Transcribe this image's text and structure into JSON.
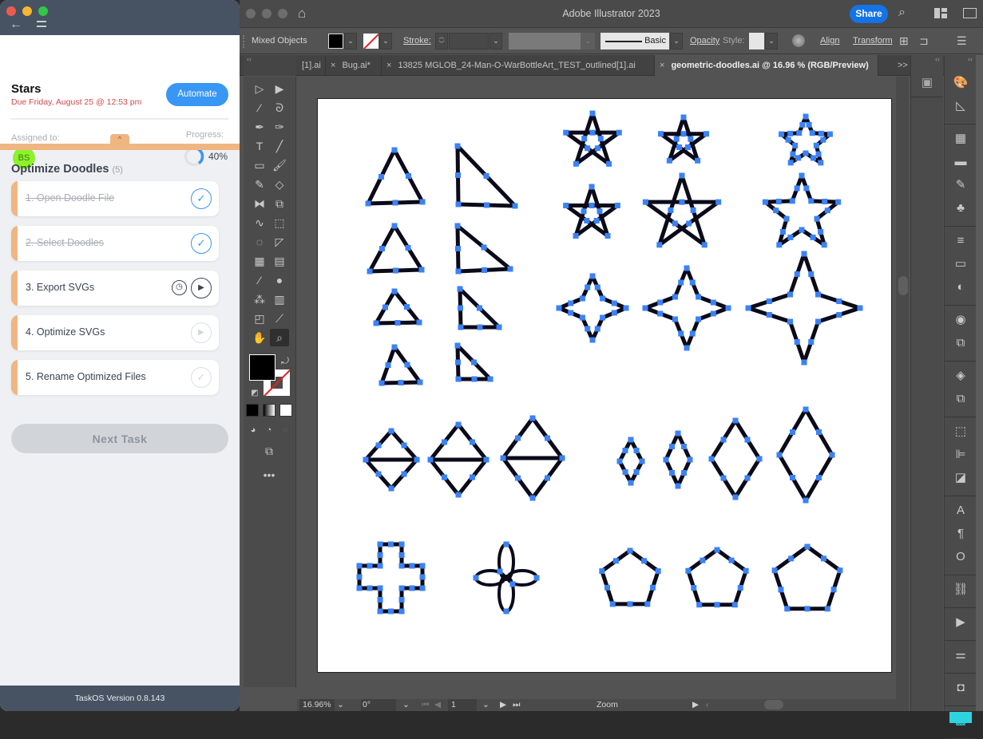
{
  "taskos": {
    "window_controls": [
      "close",
      "minimize",
      "maximize"
    ],
    "nav": {
      "back_icon": "←",
      "menu_icon": "menu-icon"
    },
    "task": {
      "title": "Stars",
      "due": "Due Friday, August 25 @ 12:53 pm",
      "automate_label": "Automate",
      "assigned_label": "Assigned to:",
      "assignee_initials": "BS",
      "progress_label": "Progress:",
      "progress_value": 40,
      "progress_text": "40%",
      "collapse_icon": "^"
    },
    "section": {
      "title": "Optimize Doodles",
      "count": "(5)"
    },
    "steps": [
      {
        "label": "1. Open Doodle File",
        "status": "done",
        "icon": "✓"
      },
      {
        "label": "2. Select Doodles",
        "status": "done",
        "icon": "✓"
      },
      {
        "label": "3. Export SVGs",
        "status": "active",
        "icon": "▶",
        "clock_icon": "◷"
      },
      {
        "label": "4. Optimize SVGs",
        "status": "pending",
        "icon": "▶"
      },
      {
        "label": "5. Rename Optimized Files",
        "status": "pending",
        "icon": "✓"
      }
    ],
    "next_task_label": "Next Task",
    "footer": "TaskOS Version 0.8.143",
    "colors": {
      "accent": "#3896f5",
      "stripe": "#f0b681",
      "due": "#d24b4b",
      "avatar": "#8ef22b",
      "header": "#475362"
    }
  },
  "illustrator": {
    "title": "Adobe Illustrator 2023",
    "share_label": "Share",
    "control_bar": {
      "selection": "Mixed Objects",
      "stroke_label": "Stroke:",
      "brush_label": "Basic",
      "opacity_label": "Opacity",
      "style_label": "Style:",
      "align_label": "Align",
      "transform_label": "Transform"
    },
    "tabs": [
      {
        "label": "[1].ai",
        "active": false
      },
      {
        "label": "Bug.ai*",
        "active": false
      },
      {
        "label": "13825 MGLOB_24-Man-O-WarBottleArt_TEST_outlined[1].ai",
        "active": false
      },
      {
        "label": "geometric-doodles.ai @ 16.96 % (RGB/Preview)",
        "active": true
      }
    ],
    "tabs_overflow": ">>",
    "status_bar": {
      "zoom": "16.96%",
      "rotation": "0°",
      "artboard": "1",
      "tool": "Zoom"
    },
    "tools": [
      "selection-tool",
      "direct-selection-tool",
      "magic-wand-tool",
      "lasso-tool",
      "pen-tool",
      "curvature-tool",
      "type-tool",
      "line-segment-tool",
      "rectangle-tool",
      "paintbrush-tool",
      "pencil-tool",
      "eraser-tool",
      "reflect-tool",
      "scale-tool",
      "warp-tool",
      "free-transform-tool",
      "shape-builder-tool",
      "perspective-grid-tool",
      "mesh-tool",
      "gradient-tool",
      "eyedropper-tool",
      "blend-tool",
      "symbol-sprayer-tool",
      "column-graph-tool",
      "artboard-tool",
      "slice-tool",
      "hand-tool",
      "zoom-tool"
    ],
    "active_tool": "zoom-tool",
    "panels": [
      "color-panel",
      "color-guide-panel",
      "swatches-panel",
      "libraries-panel",
      "brushes-panel",
      "symbols-panel",
      "stroke-panel",
      "gradient-panel",
      "transparency-panel",
      "appearance-panel",
      "graphic-styles-panel",
      "layers-panel",
      "artboards-panel",
      "transform-panel",
      "align-panel",
      "pathfinder-panel",
      "character-panel",
      "paragraph-panel",
      "opentype-panel",
      "links-panel",
      "actions-panel",
      "properties-panel",
      "asset-export-panel",
      "color-themes-panel"
    ],
    "artwork": {
      "stroke_color": "#0a0a1a",
      "anchor_color": "#3b82f6",
      "shapes": [
        {
          "type": "triangle",
          "row": 1,
          "col": 1
        },
        {
          "type": "right-triangle",
          "row": 1,
          "col": 2
        },
        {
          "type": "triangle",
          "row": 2,
          "col": 1
        },
        {
          "type": "right-triangle",
          "row": 2,
          "col": 2
        },
        {
          "type": "triangle",
          "row": 3,
          "col": 1
        },
        {
          "type": "right-triangle",
          "row": 3,
          "col": 2
        },
        {
          "type": "triangle",
          "row": 4,
          "col": 1
        },
        {
          "type": "right-triangle",
          "row": 4,
          "col": 2
        },
        {
          "type": "pentagram",
          "row": 1,
          "col": 3
        },
        {
          "type": "pentagram",
          "row": 1,
          "col": 4
        },
        {
          "type": "star-outline",
          "row": 1,
          "col": 5
        },
        {
          "type": "pentagram",
          "row": 2,
          "col": 3
        },
        {
          "type": "pentagram",
          "row": 2,
          "col": 4
        },
        {
          "type": "star-outline",
          "row": 2,
          "col": 5
        },
        {
          "type": "four-point-star",
          "row": 3,
          "col": 3
        },
        {
          "type": "four-point-star",
          "row": 3,
          "col": 4
        },
        {
          "type": "four-point-star",
          "row": 3,
          "col": 5
        },
        {
          "type": "divided-diamond",
          "count": 3
        },
        {
          "type": "diamond",
          "count": 4
        },
        {
          "type": "cross",
          "count": 1
        },
        {
          "type": "quatrefoil",
          "count": 1
        },
        {
          "type": "pentagon",
          "count": 3
        }
      ]
    }
  }
}
